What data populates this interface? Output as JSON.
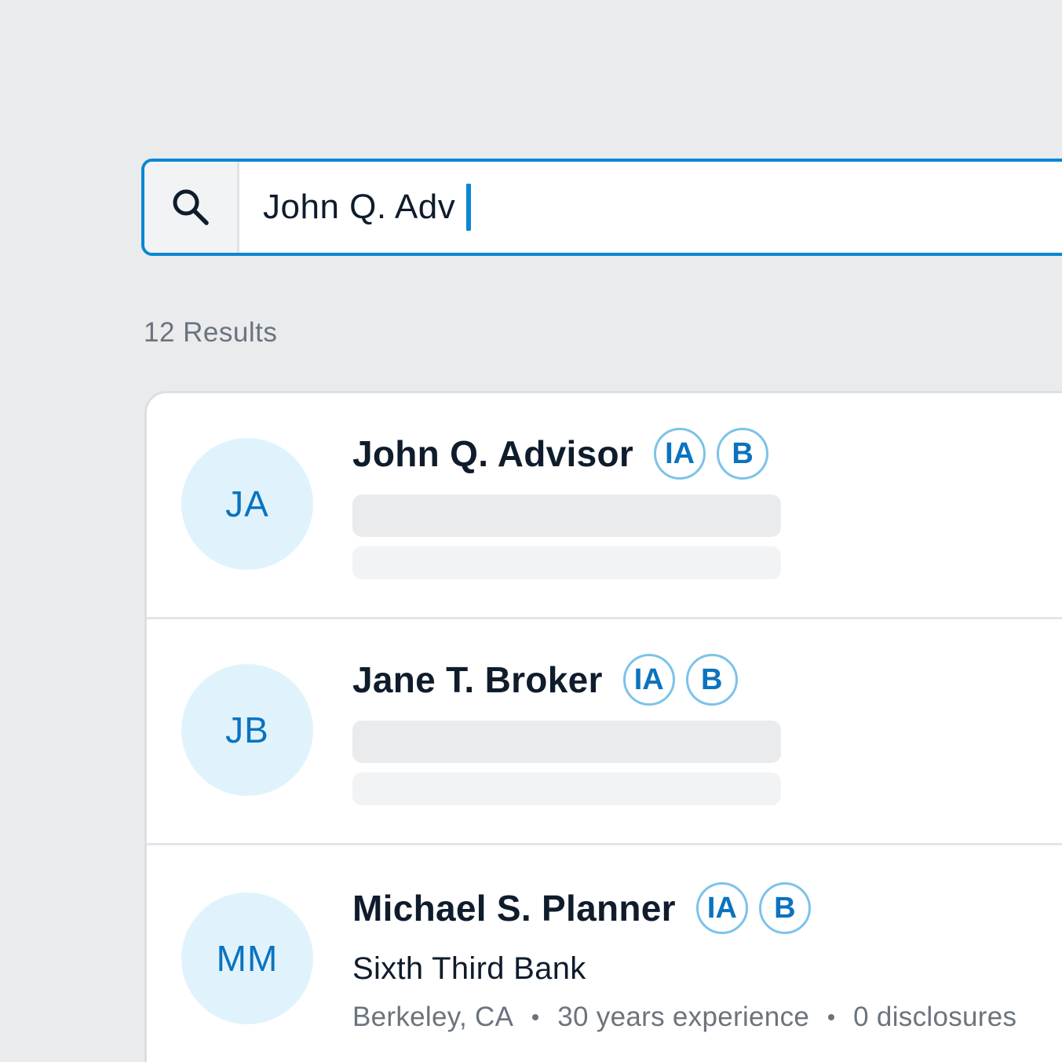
{
  "search": {
    "value": "John Q. Adv",
    "icon": "search-icon"
  },
  "results": {
    "count_label": "12 Results",
    "items": [
      {
        "initials": "JA",
        "name": "John Q. Advisor",
        "badges": [
          "IA",
          "B"
        ],
        "loading": true
      },
      {
        "initials": "JB",
        "name": "Jane T. Broker",
        "badges": [
          "IA",
          "B"
        ],
        "loading": true
      },
      {
        "initials": "MM",
        "name": "Michael S. Planner",
        "badges": [
          "IA",
          "B"
        ],
        "loading": false,
        "firm": "Sixth Third Bank",
        "location": "Berkeley, CA",
        "experience": "30 years experience",
        "disclosures": "0 disclosures"
      }
    ]
  },
  "colors": {
    "accent": "#0b86d4",
    "avatar_bg": "#e0f3fc",
    "page_bg": "#e9ebed"
  }
}
